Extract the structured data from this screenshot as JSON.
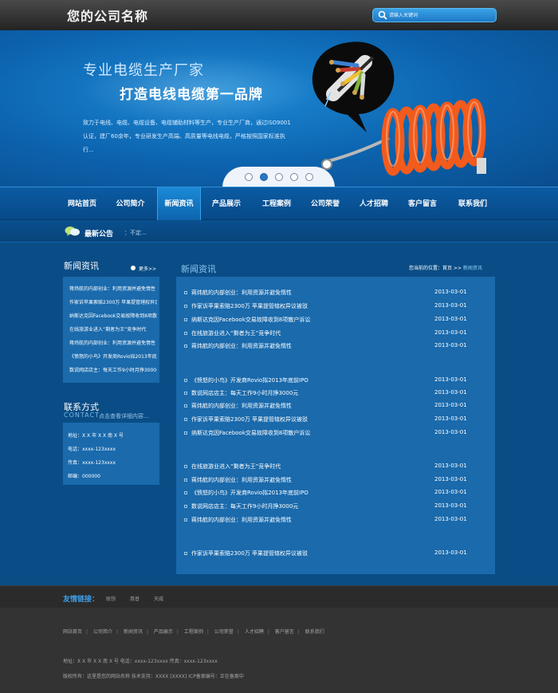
{
  "header": {
    "logo": "您的公司名称",
    "search_placeholder": "请输入关键词"
  },
  "banner": {
    "line1": "专业电缆生产厂家",
    "line2": "打造电线电缆第一品牌",
    "description": "致力于电线、电缆、电缆设备、电缆辅助材料等生产，专业生产厂商，通过ISO9001认证，建厂60余年，专业研发生产高端、高质量等电线电缆，严格按照国家标准执行...",
    "slide_count": 5,
    "active_slide": 2
  },
  "nav": {
    "items": [
      "网站首页",
      "公司简介",
      "新闻资讯",
      "产品展示",
      "工程案例",
      "公司荣誉",
      "人才招聘",
      "客户留言",
      "联系我们"
    ],
    "active_index": 2
  },
  "notice": {
    "title": "最新公告",
    "text": "：不定..."
  },
  "sidebar_news": {
    "title": "新闻资讯",
    "more": "更多>>",
    "items": [
      "蒋炜航的内部创业：利用资源并避免惰性",
      "作家诉苹果索赔2300万 苹果提管辖权异议被驳",
      "纳斯达克因Facebook交易故障收到8项散户诉讼",
      "在线旅游业进入“剩者为王”竞争时代",
      "蒋炜航的内部创业：利用资源并避免惰性",
      "《愤怒的小鸟》开发商Rovio拟2013年底前IPO",
      "数说网店店主：每天工作9小时月挣3000元"
    ]
  },
  "contact": {
    "title": "联系方式",
    "title_en": "CONTACT",
    "more": "点击查看详细内容...",
    "lines": [
      "地址：X X 市 X X 南 X 号",
      "电话：xxxx-123xxxx",
      "传真：xxxx-123xxxx",
      "邮编：000000"
    ]
  },
  "main": {
    "title": "新闻资讯",
    "breadcrumb_prefix": "您当前的位置：首页 >> ",
    "breadcrumb_current": "新闻资讯",
    "rows": [
      {
        "title": "蒋炜航的内部创业：利用资源并避免惰性",
        "date": "2013-03-01"
      },
      {
        "title": "作家诉苹果索赔2300万 苹果提管辖权异议被驳",
        "date": "2013-03-01"
      },
      {
        "title": "纳斯达克因Facebook交易故障收到8项散户诉讼",
        "date": "2013-03-01"
      },
      {
        "title": "在线旅游业进入“剩者为王”竞争时代",
        "date": "2013-03-01"
      },
      {
        "title": "蒋炜航的内部创业：利用资源并避免惰性",
        "date": "2013-03-01"
      },
      {
        "title": "《愤怒的小鸟》开发商Rovio拟2013年底前IPO",
        "date": "2013-03-01"
      },
      {
        "title": "数说网店店主：每天工作9小时月挣3000元",
        "date": "2013-03-01"
      },
      {
        "title": "蒋炜航的内部创业：利用资源并避免惰性",
        "date": "2013-03-01"
      },
      {
        "title": "作家诉苹果索赔2300万 苹果提管辖权异议被驳",
        "date": "2013-03-01"
      },
      {
        "title": "纳斯达克因Facebook交易故障收到8项散户诉讼",
        "date": "2013-03-01"
      },
      {
        "title": "在线旅游业进入“剩者为王”竞争时代",
        "date": "2013-03-01"
      },
      {
        "title": "蒋炜航的内部创业：利用资源并避免惰性",
        "date": "2013-03-01"
      },
      {
        "title": "《愤怒的小鸟》开发商Rovio拟2013年底前IPO",
        "date": "2013-03-01"
      },
      {
        "title": "数说网店店主：每天工作9小时月挣3000元",
        "date": "2013-03-01"
      },
      {
        "title": "蒋炜航的内部创业：利用资源并避免惰性",
        "date": "2013-03-01"
      },
      {
        "title": "作家诉苹果索赔2300万 苹果提管辖权异议被驳",
        "date": "2013-03-01"
      }
    ]
  },
  "friend_links": {
    "label": "友情链接：",
    "items": [
      "联想",
      "惠普",
      "天威"
    ]
  },
  "footer": {
    "nav": [
      "网站首页",
      "公司简介",
      "新闻资讯",
      "产品展示",
      "工程案例",
      "公司荣誉",
      "人才招聘",
      "客户留言",
      "联系我们"
    ],
    "address": "地址：X X 市 X X 南 X 号  电话：xxxx-123xxxx  传真：xxxx-123xxxx",
    "copyright": "版权所有：这里是您的网站名称     技术支持：XXXX [XXXX]     ICP备案编号：正在备案中"
  },
  "colors": {
    "page_bg": "#0a4d86",
    "panel_bg": "#1a6aac",
    "header_bg": "#2f2f2f",
    "accent": "#3d9de6",
    "cable_orange": "#f25b1c"
  }
}
